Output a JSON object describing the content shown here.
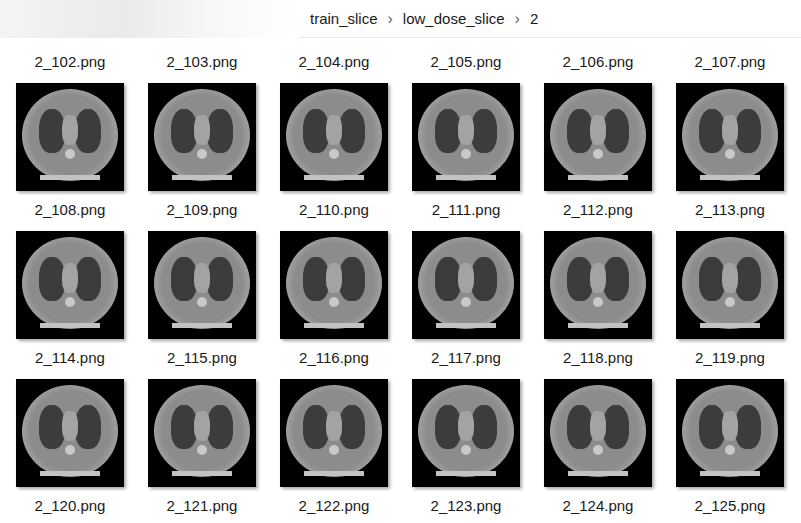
{
  "breadcrumb": {
    "items": [
      "train_slice",
      "low_dose_slice",
      "2"
    ],
    "separator": "›"
  },
  "files": [
    {
      "name": "2_102.png",
      "thumbnail": false
    },
    {
      "name": "2_103.png",
      "thumbnail": false
    },
    {
      "name": "2_104.png",
      "thumbnail": false
    },
    {
      "name": "2_105.png",
      "thumbnail": false
    },
    {
      "name": "2_106.png",
      "thumbnail": false
    },
    {
      "name": "2_107.png",
      "thumbnail": false
    },
    {
      "name": "2_108.png",
      "thumbnail": true
    },
    {
      "name": "2_109.png",
      "thumbnail": true
    },
    {
      "name": "2_110.png",
      "thumbnail": true
    },
    {
      "name": "2_111.png",
      "thumbnail": true
    },
    {
      "name": "2_112.png",
      "thumbnail": true
    },
    {
      "name": "2_113.png",
      "thumbnail": true
    },
    {
      "name": "2_114.png",
      "thumbnail": true
    },
    {
      "name": "2_115.png",
      "thumbnail": true
    },
    {
      "name": "2_116.png",
      "thumbnail": true
    },
    {
      "name": "2_117.png",
      "thumbnail": true
    },
    {
      "name": "2_118.png",
      "thumbnail": true
    },
    {
      "name": "2_119.png",
      "thumbnail": true
    },
    {
      "name": "2_120.png",
      "thumbnail": true
    },
    {
      "name": "2_121.png",
      "thumbnail": true
    },
    {
      "name": "2_122.png",
      "thumbnail": true
    },
    {
      "name": "2_123.png",
      "thumbnail": true
    },
    {
      "name": "2_124.png",
      "thumbnail": true
    },
    {
      "name": "2_125.png",
      "thumbnail": true
    }
  ]
}
